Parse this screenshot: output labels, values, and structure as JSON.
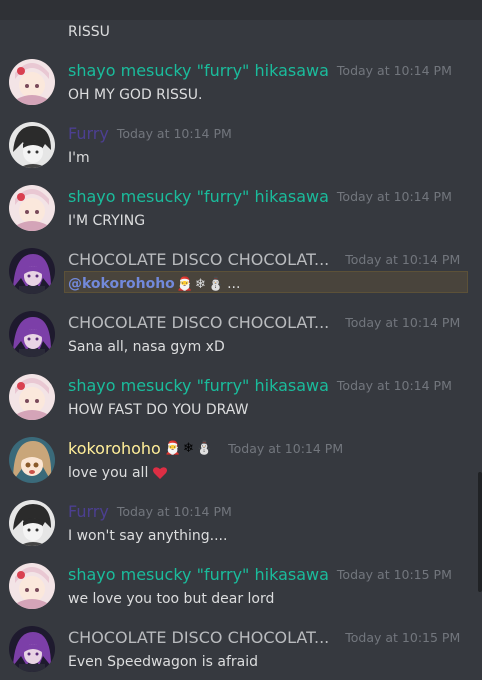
{
  "colors": {
    "background": "#36393f",
    "teal_user": "#1abc9c",
    "gray_user": "#b9bbbe",
    "purple_user": "#4c3f91",
    "yellow_user": "#ffee99",
    "mention": "#7289da",
    "timestamp": "#72767d"
  },
  "first_line": "RISSU",
  "messages": [
    {
      "user": "shayo mesucky \"furry\" hikasawa",
      "time": "Today at 10:14 PM",
      "text": "OH MY GOD RISSU."
    },
    {
      "user": "Furry",
      "time": "Today at 10:14 PM",
      "text": "I'm"
    },
    {
      "user": "shayo mesucky \"furry\" hikasawa",
      "time": "Today at 10:14 PM",
      "text": "I'M CRYING"
    },
    {
      "user": "CHOCOLATE DISCO CHOCOLAT...",
      "time": "Today at 10:14 PM",
      "mention": "@kokorohoho",
      "emojis": [
        "santa-emoji",
        "snowflake-emoji",
        "snowman-emoji"
      ],
      "text": "..."
    },
    {
      "user": "CHOCOLATE DISCO CHOCOLAT...",
      "time": "Today at 10:14 PM",
      "text": "Sana all, nasa gym xD"
    },
    {
      "user": "shayo mesucky \"furry\" hikasawa",
      "time": "Today at 10:14 PM",
      "text": "HOW FAST DO YOU DRAW"
    },
    {
      "user": "kokorohoho",
      "user_emojis": [
        "santa-emoji",
        "snowflake-emoji",
        "snowman-emoji"
      ],
      "time": "Today at 10:14 PM",
      "text": "love you all",
      "trailing_icon": "heart-icon"
    },
    {
      "user": "Furry",
      "time": "Today at 10:14 PM",
      "text": "I won't say anything...."
    },
    {
      "user": "shayo mesucky \"furry\" hikasawa",
      "time": "Today at 10:15 PM",
      "text": "we love you too but dear lord"
    },
    {
      "user": "CHOCOLATE DISCO CHOCOLAT...",
      "time": "Today at 10:15 PM",
      "text": "Even Speedwagon is afraid"
    }
  ]
}
